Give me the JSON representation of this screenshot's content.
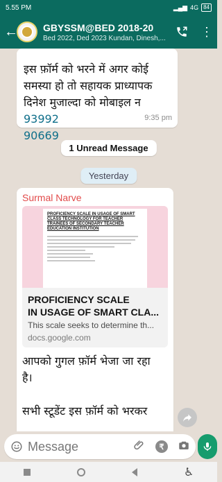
{
  "status": {
    "time": "5.55 PM",
    "signal": "4G",
    "battery": "84"
  },
  "appbar": {
    "title": "GBYSSM@BED 2018-20",
    "subtitle": "Bed 2022, Ded 2023 Kundan, Dinesh,..."
  },
  "chat": {
    "msg1": {
      "line1": "इस फ़ॉर्म को भरने में अगर कोई",
      "line2": "समस्या हो तो सहायक प्राध्यापक",
      "line3": "दिनेश मुजाल्दा को मोबाइल न",
      "phone1": "93992",
      "phone2": "90669",
      "time": "9:35 pm"
    },
    "unread_label": "1 Unread Message",
    "date_label": "Yesterday",
    "msg2": {
      "sender": "Surmal Narve",
      "doc_preview_title": "PROFICIENCY SCALE IN USAGE OF SMART CLASS TECHNOLOGY FOR TEACHER TRAINEES OF SECONDARY TEACHER EDUCATION INSTITUTION",
      "link_title_line1": "PROFICIENCY SCALE",
      "link_title_line2": "IN USAGE OF SMART CLA...",
      "link_desc": "This scale seeks to determine th...",
      "link_domain": "docs.google.com",
      "text_line1": "आपको गुगल फ़ॉर्म भेजा जा रहा",
      "text_line2": "है।",
      "text_line3": "सभी स्टूडेंट इस फ़ॉर्म को भरकर"
    }
  },
  "composer": {
    "placeholder": "Message"
  },
  "colors": {
    "header": "#0b6b5f",
    "chat_bg": "#e5ddd5",
    "mic": "#169c6d",
    "sender_name": "#e24a4a",
    "phone_link": "#0f6f8a"
  },
  "icons": [
    "back-arrow-icon",
    "group-avatar-icon",
    "call-icon",
    "menu-icon",
    "forward-icon",
    "emoji-icon",
    "attach-icon",
    "rupee-icon",
    "camera-icon",
    "mic-icon"
  ]
}
